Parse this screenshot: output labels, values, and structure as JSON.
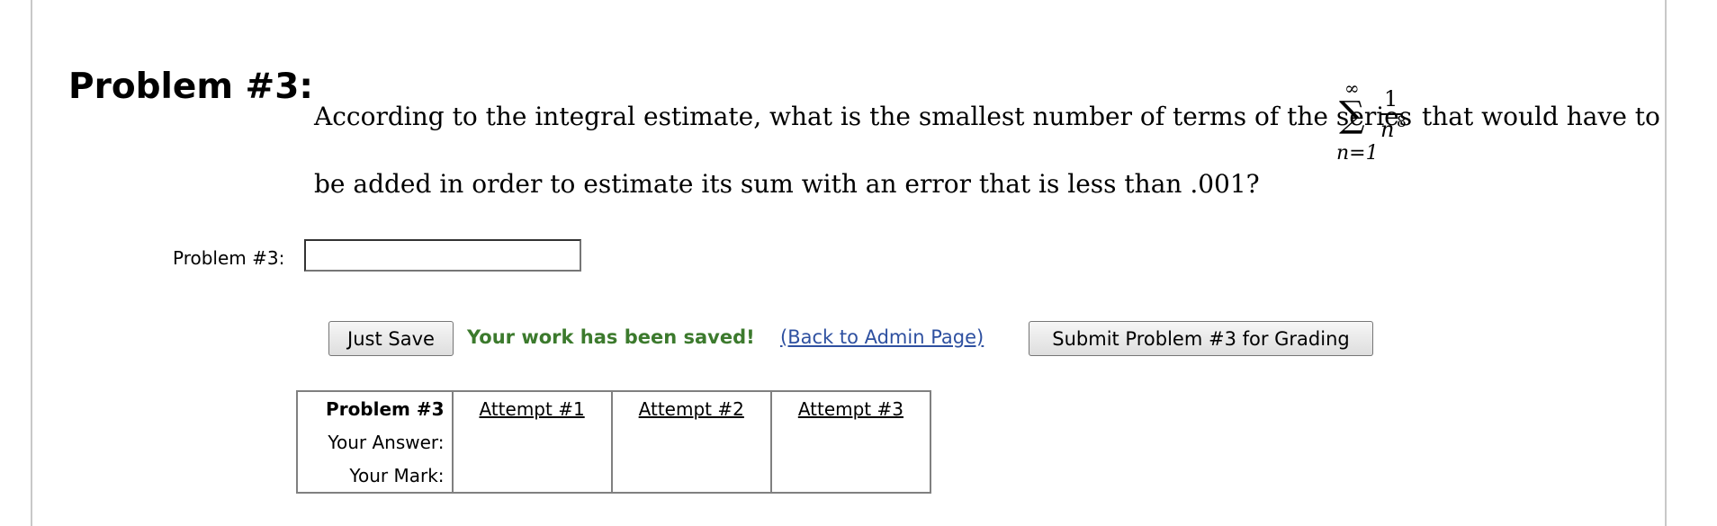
{
  "problem": {
    "title": "Problem #3:",
    "question_part1": "According to the integral estimate, what is the smallest number of terms of the series",
    "question_part2": "that would have to",
    "question_line2": "be added in order to estimate its sum with an error that is less than .001?",
    "series": {
      "upper": "∞",
      "sigma": "∑",
      "lower": "n=1",
      "numerator": "1",
      "denominator": "n",
      "exponent": "8"
    }
  },
  "answer": {
    "label": "Problem #3:",
    "value": ""
  },
  "actions": {
    "save_label": "Just Save",
    "saved_message": "Your work has been saved!",
    "admin_link": "(Back to Admin Page)",
    "submit_label": "Submit Problem #3 for Grading"
  },
  "attempts_table": {
    "header": "Problem #3",
    "columns": [
      "Attempt #1",
      "Attempt #2",
      "Attempt #3"
    ],
    "rows": [
      {
        "label": "Your Answer:",
        "values": [
          "",
          "",
          ""
        ]
      },
      {
        "label": "Your Mark:",
        "values": [
          "",
          "",
          ""
        ]
      }
    ]
  },
  "colors": {
    "saved_message": "#3c7a2d",
    "link": "#2e50a0"
  }
}
